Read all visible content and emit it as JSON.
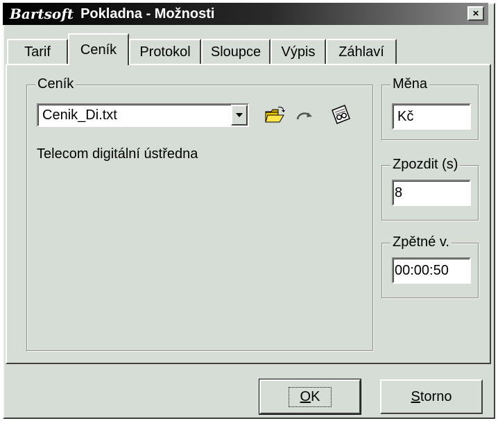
{
  "window": {
    "brand": "Bartsoft",
    "title": "Pokladna - Možnosti",
    "close_glyph": "×"
  },
  "tabs": [
    {
      "label": "Tarif",
      "active": false
    },
    {
      "label": "Ceník",
      "active": true
    },
    {
      "label": "Protokol",
      "active": false
    },
    {
      "label": "Sloupce",
      "active": false
    },
    {
      "label": "Výpis",
      "active": false
    },
    {
      "label": "Záhlaví",
      "active": false
    }
  ],
  "cenik": {
    "legend": "Ceník",
    "selected_file": "Cenik_Di.txt",
    "description": "Telecom digitální ústředna",
    "icons": [
      "open-folder-icon",
      "reload-arrow-icon",
      "view-icon"
    ]
  },
  "mena": {
    "legend": "Měna",
    "value": "Kč"
  },
  "zpozdit": {
    "legend": "Zpozdit (s)",
    "value": "8"
  },
  "zpetne": {
    "legend": "Zpětné v.",
    "value": "00:00:50"
  },
  "buttons": {
    "ok": {
      "mnemonic": "O",
      "rest": "K"
    },
    "storno": {
      "mnemonic": "S",
      "rest": "torno"
    }
  }
}
